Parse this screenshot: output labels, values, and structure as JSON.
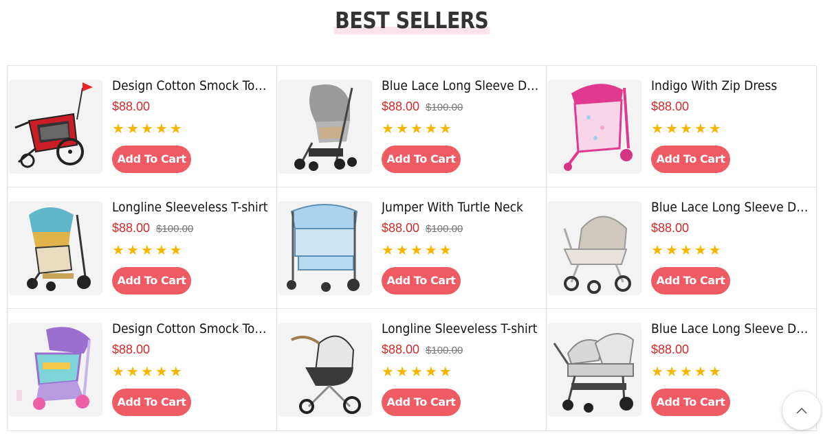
{
  "section": {
    "title": "BEST SELLERS"
  },
  "colors": {
    "accent": "#ef5b63",
    "price": "#d42a2a",
    "star": "#f7b500",
    "highlight": "#fde4ec"
  },
  "products": [
    {
      "name": "Design Cotton Smock Top I...",
      "price": "$88.00",
      "old_price": "",
      "rating": 5,
      "button": "Add To Cart",
      "image": "bike-trailer-stroller-red"
    },
    {
      "name": "Blue Lace Long Sleeve Dress",
      "price": "$88.00",
      "old_price": "$100.00",
      "rating": 5,
      "button": "Add To Cart",
      "image": "stroller-grey"
    },
    {
      "name": "Indigo With Zip Dress",
      "price": "$88.00",
      "old_price": "",
      "rating": 5,
      "button": "Add To Cart",
      "image": "doll-stroller-pink"
    },
    {
      "name": "Longline Sleeveless T-shirt",
      "price": "$88.00",
      "old_price": "$100.00",
      "rating": 5,
      "button": "Add To Cart",
      "image": "stroller-teal-yellow"
    },
    {
      "name": "Jumper With Turtle Neck",
      "price": "$88.00",
      "old_price": "$100.00",
      "rating": 5,
      "button": "Add To Cart",
      "image": "stroller-blue-canopy"
    },
    {
      "name": "Blue Lace Long Sleeve Dress",
      "price": "$88.00",
      "old_price": "",
      "rating": 5,
      "button": "Add To Cart",
      "image": "pram-white"
    },
    {
      "name": "Design Cotton Smock Top I...",
      "price": "$88.00",
      "old_price": "",
      "rating": 5,
      "button": "Add To Cart",
      "image": "toy-stroller-purple"
    },
    {
      "name": "Longline Sleeveless T-shirt",
      "price": "$88.00",
      "old_price": "$100.00",
      "rating": 5,
      "button": "Add To Cart",
      "image": "stroller-black-white"
    },
    {
      "name": "Blue Lace Long Sleeve Dress",
      "price": "$88.00",
      "old_price": "",
      "rating": 5,
      "button": "Add To Cart",
      "image": "twin-stroller-white"
    }
  ],
  "scroll_top": {
    "icon": "chevron-up-icon"
  }
}
